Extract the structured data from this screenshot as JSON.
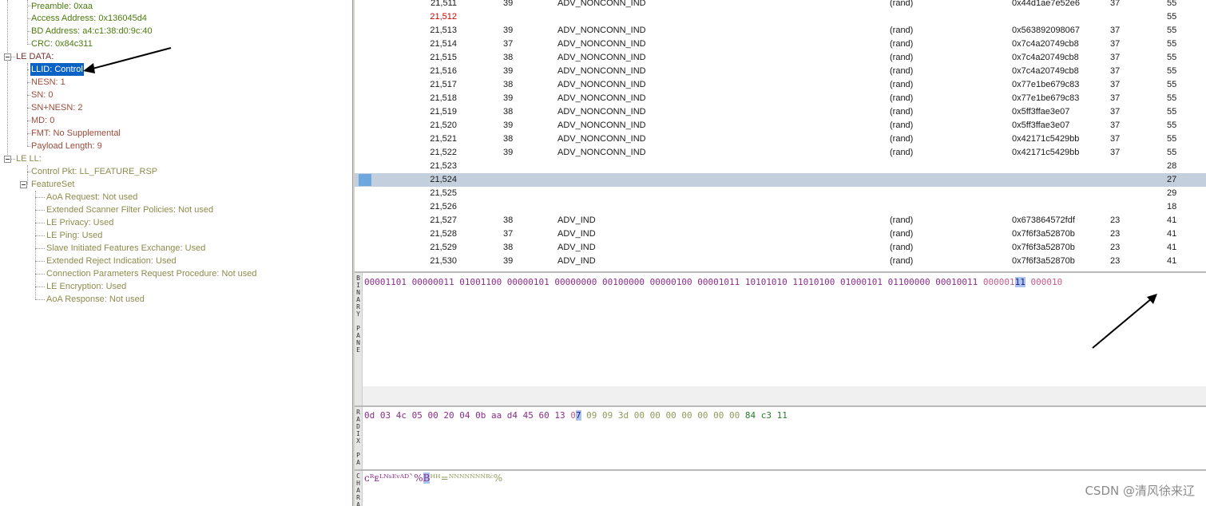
{
  "colors": {
    "tree_green": "#4d7a0d",
    "tree_brown": "#9e4a3a",
    "tree_olive": "#8c8c4c",
    "selected_bg": "#0a62c4",
    "selected_row": "#c3cfdc",
    "bin_purple": "#8b2d8b",
    "bin_pink": "#c65c8c",
    "hex_green": "#2a7a2a",
    "hex_olive": "#8f9a5a"
  },
  "tree": {
    "access_header": [
      {
        "label": "Preamble: 0xaa"
      },
      {
        "label": "Access Address: 0x136045d4"
      },
      {
        "label": "BD Address: a4:c1:38:d0:9c:40"
      },
      {
        "label": "CRC: 0x84c311"
      }
    ],
    "le_data": {
      "label": "LE DATA:",
      "children": [
        {
          "label": "LLID: Control",
          "selected": true
        },
        {
          "label": "NESN: 1"
        },
        {
          "label": "SN: 0"
        },
        {
          "label": "SN+NESN: 2"
        },
        {
          "label": "MD: 0"
        },
        {
          "label": "FMT: No Supplemental"
        },
        {
          "label": "Payload Length: 9"
        }
      ]
    },
    "le_ll": {
      "label": "LE LL:",
      "control_pkt": "Control Pkt: LL_FEATURE_RSP",
      "featureset": "FeatureSet",
      "features": [
        {
          "label": "AoA Request: Not used"
        },
        {
          "label": "Extended Scanner Filter Policies: Not used"
        },
        {
          "label": "LE Privacy: Used"
        },
        {
          "label": "LE Ping: Used"
        },
        {
          "label": "Slave Initiated Features Exchange: Used"
        },
        {
          "label": "Extended Reject Indication: Used"
        },
        {
          "label": "Connection Parameters Request Procedure: Not used"
        },
        {
          "label": "LE Encryption: Used"
        },
        {
          "label": "AoA Response: Not used"
        }
      ]
    }
  },
  "packets": [
    {
      "no": "21,511",
      "ch": "39",
      "type": "ADV_NONCONN_IND",
      "addr": "(rand)",
      "aa": "0x44d1ae7e52e6",
      "len": "37",
      "crc": "55"
    },
    {
      "no": "21,512",
      "ch": "",
      "type": "",
      "addr": "",
      "aa": "",
      "len": "",
      "crc": "55",
      "red": true
    },
    {
      "no": "21,513",
      "ch": "39",
      "type": "ADV_NONCONN_IND",
      "addr": "(rand)",
      "aa": "0x563892098067",
      "len": "37",
      "crc": "55"
    },
    {
      "no": "21,514",
      "ch": "37",
      "type": "ADV_NONCONN_IND",
      "addr": "(rand)",
      "aa": "0x7c4a20749cb8",
      "len": "37",
      "crc": "55"
    },
    {
      "no": "21,515",
      "ch": "38",
      "type": "ADV_NONCONN_IND",
      "addr": "(rand)",
      "aa": "0x7c4a20749cb8",
      "len": "37",
      "crc": "55"
    },
    {
      "no": "21,516",
      "ch": "39",
      "type": "ADV_NONCONN_IND",
      "addr": "(rand)",
      "aa": "0x7c4a20749cb8",
      "len": "37",
      "crc": "55"
    },
    {
      "no": "21,517",
      "ch": "38",
      "type": "ADV_NONCONN_IND",
      "addr": "(rand)",
      "aa": "0x77e1be679c83",
      "len": "37",
      "crc": "55"
    },
    {
      "no": "21,518",
      "ch": "39",
      "type": "ADV_NONCONN_IND",
      "addr": "(rand)",
      "aa": "0x77e1be679c83",
      "len": "37",
      "crc": "55"
    },
    {
      "no": "21,519",
      "ch": "38",
      "type": "ADV_NONCONN_IND",
      "addr": "(rand)",
      "aa": "0x5ff3ffae3e07",
      "len": "37",
      "crc": "55"
    },
    {
      "no": "21,520",
      "ch": "39",
      "type": "ADV_NONCONN_IND",
      "addr": "(rand)",
      "aa": "0x5ff3ffae3e07",
      "len": "37",
      "crc": "55"
    },
    {
      "no": "21,521",
      "ch": "38",
      "type": "ADV_NONCONN_IND",
      "addr": "(rand)",
      "aa": "0x42171c5429bb",
      "len": "37",
      "crc": "55"
    },
    {
      "no": "21,522",
      "ch": "39",
      "type": "ADV_NONCONN_IND",
      "addr": "(rand)",
      "aa": "0x42171c5429bb",
      "len": "37",
      "crc": "55"
    },
    {
      "no": "21,523",
      "ch": "",
      "type": "",
      "addr": "",
      "aa": "",
      "len": "",
      "crc": "28"
    },
    {
      "no": "21,524",
      "ch": "",
      "type": "",
      "addr": "",
      "aa": "",
      "len": "",
      "crc": "27",
      "selected": true
    },
    {
      "no": "21,525",
      "ch": "",
      "type": "",
      "addr": "",
      "aa": "",
      "len": "",
      "crc": "29"
    },
    {
      "no": "21,526",
      "ch": "",
      "type": "",
      "addr": "",
      "aa": "",
      "len": "",
      "crc": "18"
    },
    {
      "no": "21,527",
      "ch": "38",
      "type": "ADV_IND",
      "addr": "(rand)",
      "aa": "0x673864572fdf",
      "len": "23",
      "crc": "41"
    },
    {
      "no": "21,528",
      "ch": "37",
      "type": "ADV_IND",
      "addr": "(rand)",
      "aa": "0x7f6f3a52870b",
      "len": "23",
      "crc": "41"
    },
    {
      "no": "21,529",
      "ch": "38",
      "type": "ADV_IND",
      "addr": "(rand)",
      "aa": "0x7f6f3a52870b",
      "len": "23",
      "crc": "41"
    },
    {
      "no": "21,530",
      "ch": "39",
      "type": "ADV_IND",
      "addr": "(rand)",
      "aa": "0x7f6f3a52870b",
      "len": "23",
      "crc": "41"
    }
  ],
  "binary_pane": {
    "label": "BINARY PANE",
    "bytes": [
      "00001101",
      "00000011",
      "01001100",
      "00000101",
      "00000000",
      "00100000",
      "00000100",
      "00001011",
      "10101010",
      "11010100",
      "01000101",
      "01100000",
      "00010011"
    ],
    "pink_prefix": "000001",
    "highlight": "11",
    "tail": "000010"
  },
  "radix_pane": {
    "label": "RADIX PA",
    "bytes": [
      "0d",
      "03",
      "4c",
      "05",
      "00",
      "20",
      "04",
      "0b",
      "aa",
      "d4",
      "45",
      "60",
      "13"
    ],
    "hl_pre": "0",
    "hl": "7",
    "olive": [
      "09",
      "09",
      "3d",
      "00",
      "00",
      "00",
      "00",
      "00",
      "00",
      "00"
    ],
    "green": [
      "84",
      "c3",
      "11"
    ]
  },
  "char_pane": {
    "label": "CHARA",
    "text_a": "ᴄᴿᴇᴸᴺˢᴱᵛᴬᴰ`%",
    "hl": "B",
    "text_b": "ᴴᴴ=ᴺᴺᴺᴺᴺᴺᴺᴿᶜ%"
  },
  "watermark": "CSDN @清风徐来辽"
}
